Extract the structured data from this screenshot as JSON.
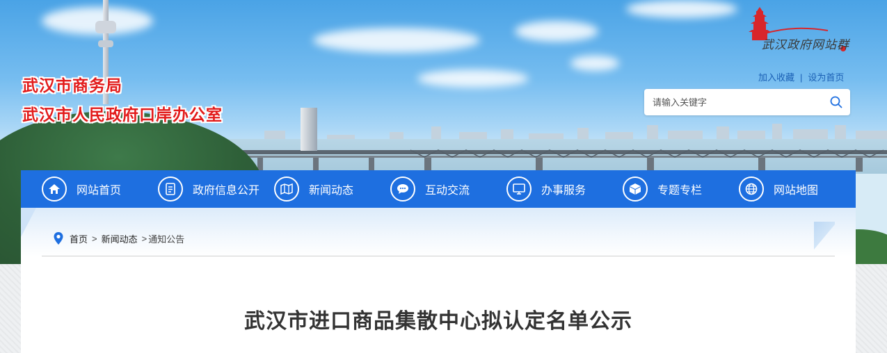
{
  "header": {
    "title_line1": "武汉市商务局",
    "title_line2": "武汉市人民政府口岸办公室",
    "logo_text": "武汉政府网站群",
    "links": {
      "favorite": "加入收藏",
      "separator": "|",
      "homepage": "设为首页"
    },
    "search": {
      "placeholder": "请输入关键字",
      "icon": "search-icon"
    }
  },
  "nav": {
    "items": [
      {
        "label": "网站首页",
        "icon": "home-icon"
      },
      {
        "label": "政府信息公开",
        "icon": "document-icon"
      },
      {
        "label": "新闻动态",
        "icon": "map-book-icon"
      },
      {
        "label": "互动交流",
        "icon": "chat-icon"
      },
      {
        "label": "办事服务",
        "icon": "monitor-icon"
      },
      {
        "label": "专题专栏",
        "icon": "cube-icon"
      },
      {
        "label": "网站地图",
        "icon": "globe-icon"
      }
    ],
    "accent_color": "#1e6fe0"
  },
  "breadcrumb": {
    "icon": "location-pin-icon",
    "home": "首页",
    "sep1": ">",
    "section": "新闻动态",
    "sep2": ">",
    "current": "通知公告"
  },
  "article": {
    "title": "武汉市进口商品集散中心拟认定名单公示"
  }
}
